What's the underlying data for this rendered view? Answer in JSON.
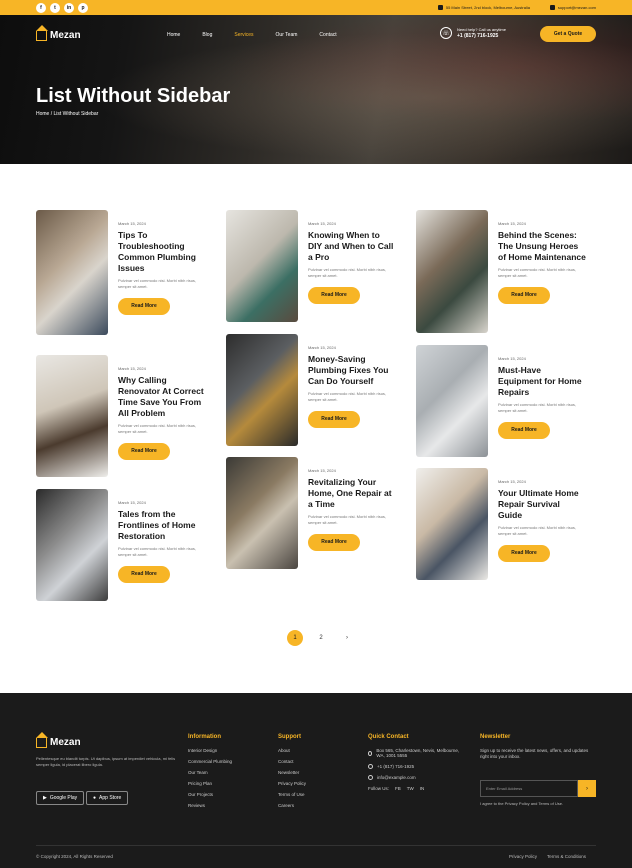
{
  "topbar": {
    "socials": [
      "f",
      "t",
      "in",
      "p"
    ],
    "address": "55 Main Street, 2nd block, Melbourne, Australia",
    "email": "support@mezan.com"
  },
  "header": {
    "logo": "Mezan",
    "nav": [
      "Home",
      "Blog",
      "Services",
      "Our Team",
      "Contact"
    ],
    "call_label": "Need help? Call us anytime",
    "call_number": "+1 (817) 716-1925",
    "cta": "Get a Quote"
  },
  "hero": {
    "title": "List Without Sidebar",
    "breadcrumb_home": "Home",
    "breadcrumb_sep": "/",
    "breadcrumb_current": "List Without Sidebar"
  },
  "posts": [
    {
      "date": "March 15, 2024",
      "title": "Tips To Troubleshooting Common Plumbing Issues",
      "excerpt": "Pulvinar vel commodo nisi. Morbi nibh risus, semper sit amet.",
      "cta": "Read More"
    },
    {
      "date": "March 15, 2024",
      "title": "Knowing When to DIY and When to Call a Pro",
      "excerpt": "Pulvinar vel commodo nisi. Morbi nibh risus, semper sit amet.",
      "cta": "Read More"
    },
    {
      "date": "March 15, 2024",
      "title": "Behind the Scenes: The Unsung Heroes of Home Maintenance",
      "excerpt": "Pulvinar vel commodo nisi. Morbi nibh risus, semper sit amet.",
      "cta": "Read More"
    },
    {
      "date": "March 15, 2024",
      "title": "Why Calling Renovator At Correct Time Save You From All Problem",
      "excerpt": "Pulvinar vel commodo nisi. Morbi nibh risus, semper sit amet.",
      "cta": "Read More"
    },
    {
      "date": "March 15, 2024",
      "title": "Money-Saving Plumbing Fixes You Can Do Yourself",
      "excerpt": "Pulvinar vel commodo nisi. Morbi nibh risus, semper sit amet.",
      "cta": "Read More"
    },
    {
      "date": "March 15, 2024",
      "title": "Must-Have Equipment for Home Repairs",
      "excerpt": "Pulvinar vel commodo nisi. Morbi nibh risus, semper sit amet.",
      "cta": "Read More"
    },
    {
      "date": "March 15, 2024",
      "title": "Tales from the Frontlines of Home Restoration",
      "excerpt": "Pulvinar vel commodo nisi. Morbi nibh risus, semper sit amet.",
      "cta": "Read More"
    },
    {
      "date": "March 15, 2024",
      "title": "Revitalizing Your Home, One Repair at a Time",
      "excerpt": "Pulvinar vel commodo nisi. Morbi nibh risus, semper sit amet.",
      "cta": "Read More"
    },
    {
      "date": "March 15, 2024",
      "title": "Your Ultimate Home Repair Survival Guide",
      "excerpt": "Pulvinar vel commodo nisi. Morbi nibh risus, semper sit amet.",
      "cta": "Read More"
    }
  ],
  "pagination": {
    "pages": [
      "1",
      "2"
    ],
    "next": "›"
  },
  "footer": {
    "logo": "Mezan",
    "description": "Pellentesque eu blandit turpis. Ut dapibus, ipsum at imperdiet vehicula, mi felis semper ligula, id placerat libero ligula.",
    "google_play": "Google Play",
    "app_store": "App Store",
    "col1_title": "Information",
    "col1_items": [
      "Interior Design",
      "Commercial Plumbing",
      "Our Team",
      "Pricing Plan",
      "Our Projects",
      "Reviews"
    ],
    "col2_title": "Support",
    "col2_items": [
      "About",
      "Contact",
      "Newsletter",
      "Privacy Policy",
      "Terms of Use",
      "Careers"
    ],
    "col3_title": "Quick Contact",
    "contact_address": "Box 565, Charlestown, Nevis, Melbourne, WA, 1001 5555",
    "contact_phone": "+1 (817) 716-1925",
    "contact_email": "info@example.com",
    "follow_label": "Follow Us:",
    "follow_links": [
      "FB",
      "TW",
      "IN"
    ],
    "col4_title": "Newsletter",
    "news_text": "Sign up to receive the latest news, offers, and updates right into your inbox.",
    "news_placeholder": "Enter Email Address",
    "news_button": "›",
    "agree": "I agree to the Privacy Policy and Terms of Use.",
    "copyright": "© Copyright 2024, All Rights Reserved",
    "privacy": "Privacy Policy",
    "terms": "Terms & Conditions"
  }
}
